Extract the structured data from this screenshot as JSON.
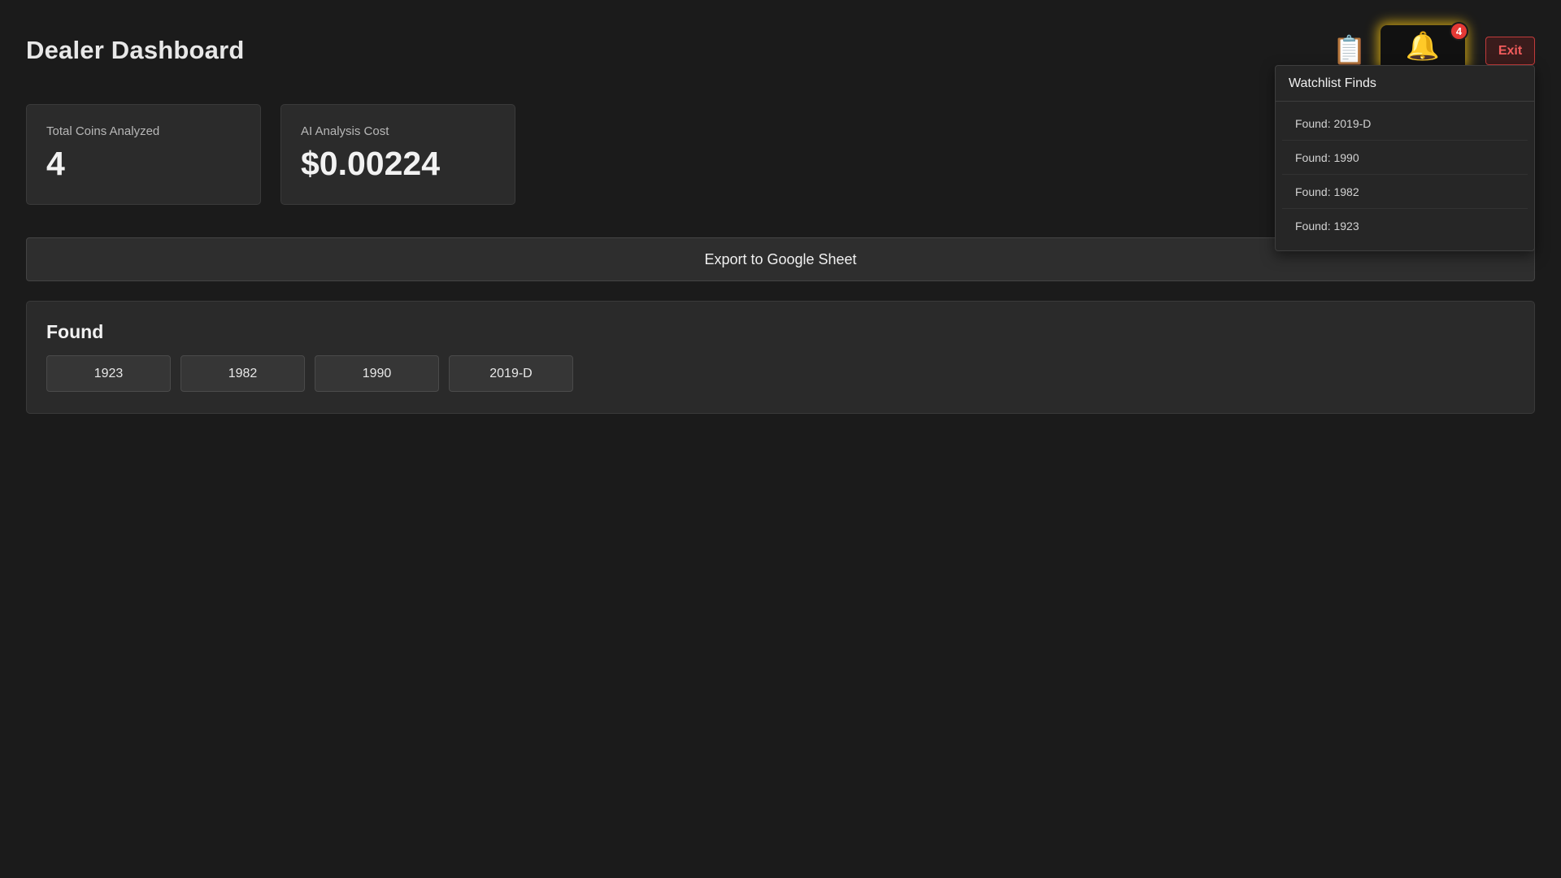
{
  "header": {
    "title": "Dealer Dashboard",
    "clipboard_icon": "📋",
    "bell_icon": "🔔",
    "notification_count": "4",
    "exit_label": "Exit"
  },
  "stats": [
    {
      "label": "Total Coins Analyzed",
      "value": "4"
    },
    {
      "label": "AI Analysis Cost",
      "value": "$0.00224"
    }
  ],
  "export_label": "Export to Google Sheet",
  "found": {
    "title": "Found",
    "items": [
      "1923",
      "1982",
      "1990",
      "2019-D"
    ]
  },
  "watchlist": {
    "title": "Watchlist Finds",
    "items": [
      "Found: 2019-D",
      "Found: 1990",
      "Found: 1982",
      "Found: 1923"
    ]
  },
  "colors": {
    "background": "#1b1b1b",
    "card": "#2b2b2b",
    "badge": "#e53935",
    "exit_text": "#f25c5c",
    "bell_glow": "#d6aa14"
  }
}
